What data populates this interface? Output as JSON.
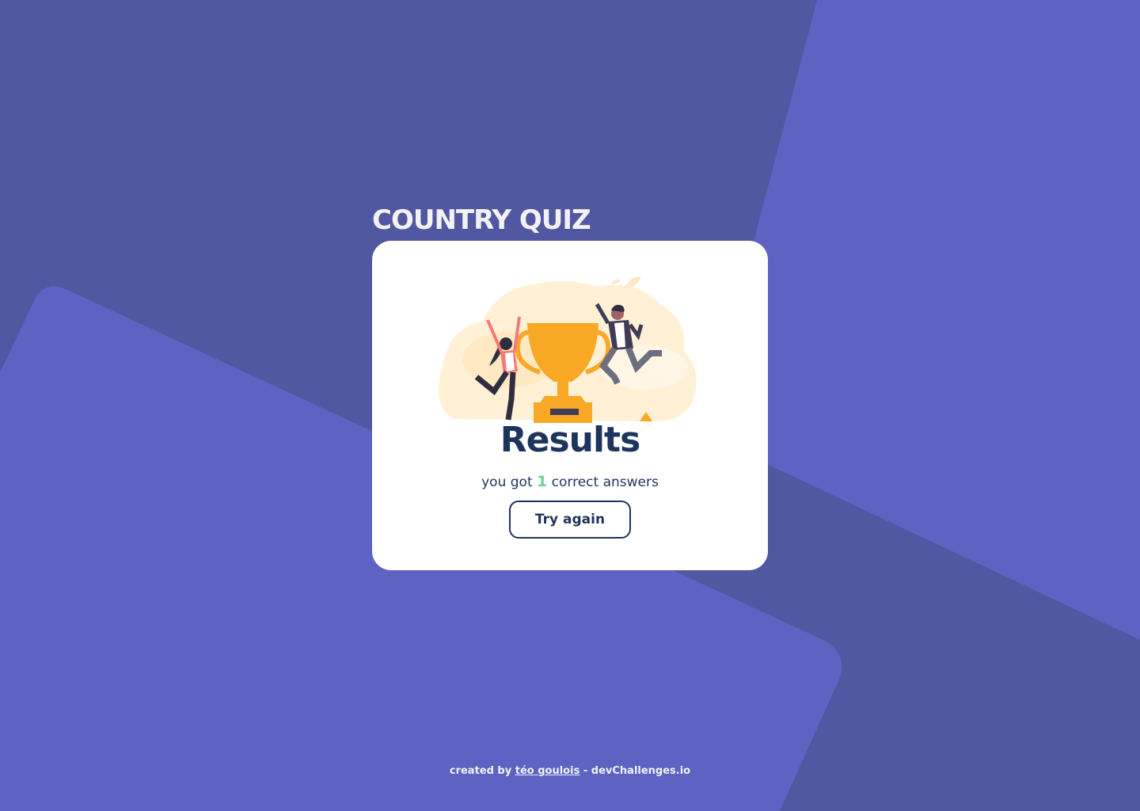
{
  "app": {
    "title": "COUNTRY QUIZ"
  },
  "results": {
    "heading": "Results",
    "score_prefix": "you got",
    "score": "1",
    "score_suffix": "correct answers",
    "button_label": "Try again",
    "illustration_icon": "winners-trophy-illustration"
  },
  "footer": {
    "prefix": "created by",
    "author": "téo goulois",
    "separator": "-",
    "site": "devChallenges.io"
  },
  "colors": {
    "background": "#5157A0",
    "background_accent": "#5D62C3",
    "card": "#FFFFFF",
    "heading": "#1D355D",
    "score_accent": "#6FCF97",
    "trophy": "#F9A826",
    "title_text": "#F2F2F2"
  }
}
